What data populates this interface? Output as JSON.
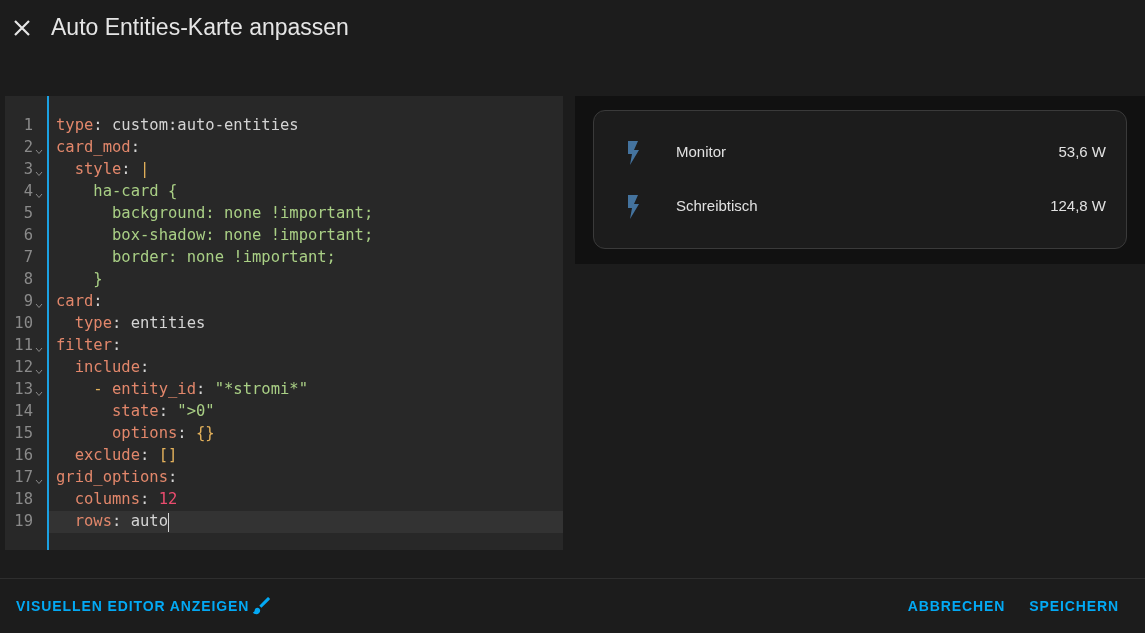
{
  "dialog": {
    "title": "Auto Entities-Karte anpassen"
  },
  "editor": {
    "lines": [
      {
        "number": "1",
        "foldable": false,
        "active": false,
        "tokens": [
          {
            "kind": "key",
            "text": "type"
          },
          {
            "kind": "punct",
            "text": ":"
          },
          {
            "kind": "plain",
            "text": " custom:auto-entities"
          }
        ]
      },
      {
        "number": "2",
        "foldable": true,
        "active": false,
        "tokens": [
          {
            "kind": "key",
            "text": "card_mod"
          },
          {
            "kind": "punct",
            "text": ":"
          }
        ]
      },
      {
        "number": "3",
        "foldable": true,
        "active": false,
        "tokens": [
          {
            "kind": "key",
            "text": "  style"
          },
          {
            "kind": "punct",
            "text": ":"
          },
          {
            "kind": "bracket",
            "text": " |"
          }
        ]
      },
      {
        "number": "4",
        "foldable": true,
        "active": false,
        "tokens": [
          {
            "kind": "string",
            "text": "    ha-card {"
          }
        ]
      },
      {
        "number": "5",
        "foldable": false,
        "active": false,
        "tokens": [
          {
            "kind": "string",
            "text": "      background: none !important;"
          }
        ]
      },
      {
        "number": "6",
        "foldable": false,
        "active": false,
        "tokens": [
          {
            "kind": "string",
            "text": "      box-shadow: none !important;"
          }
        ]
      },
      {
        "number": "7",
        "foldable": false,
        "active": false,
        "tokens": [
          {
            "kind": "string",
            "text": "      border: none !important;"
          }
        ]
      },
      {
        "number": "8",
        "foldable": false,
        "active": false,
        "tokens": [
          {
            "kind": "string",
            "text": "    }"
          }
        ]
      },
      {
        "number": "9",
        "foldable": true,
        "active": false,
        "tokens": [
          {
            "kind": "key",
            "text": "card"
          },
          {
            "kind": "punct",
            "text": ":"
          }
        ]
      },
      {
        "number": "10",
        "foldable": false,
        "active": false,
        "tokens": [
          {
            "kind": "key",
            "text": "  type"
          },
          {
            "kind": "punct",
            "text": ":"
          },
          {
            "kind": "plain",
            "text": " entities"
          }
        ]
      },
      {
        "number": "11",
        "foldable": true,
        "active": false,
        "tokens": [
          {
            "kind": "key",
            "text": "filter"
          },
          {
            "kind": "punct",
            "text": ":"
          }
        ]
      },
      {
        "number": "12",
        "foldable": true,
        "active": false,
        "tokens": [
          {
            "kind": "key",
            "text": "  include"
          },
          {
            "kind": "punct",
            "text": ":"
          }
        ]
      },
      {
        "number": "13",
        "foldable": true,
        "active": false,
        "tokens": [
          {
            "kind": "bracket",
            "text": "    - "
          },
          {
            "kind": "key",
            "text": "entity_id"
          },
          {
            "kind": "punct",
            "text": ":"
          },
          {
            "kind": "string",
            "text": " \"*stromi*\""
          }
        ]
      },
      {
        "number": "14",
        "foldable": false,
        "active": false,
        "tokens": [
          {
            "kind": "key",
            "text": "      state"
          },
          {
            "kind": "punct",
            "text": ":"
          },
          {
            "kind": "string",
            "text": " \">0\""
          }
        ]
      },
      {
        "number": "15",
        "foldable": false,
        "active": false,
        "tokens": [
          {
            "kind": "key",
            "text": "      options"
          },
          {
            "kind": "punct",
            "text": ":"
          },
          {
            "kind": "bracket",
            "text": " {}"
          }
        ]
      },
      {
        "number": "16",
        "foldable": false,
        "active": false,
        "tokens": [
          {
            "kind": "key",
            "text": "  exclude"
          },
          {
            "kind": "punct",
            "text": ":"
          },
          {
            "kind": "bracket",
            "text": " []"
          }
        ]
      },
      {
        "number": "17",
        "foldable": true,
        "active": false,
        "tokens": [
          {
            "kind": "key",
            "text": "grid_options"
          },
          {
            "kind": "punct",
            "text": ":"
          }
        ]
      },
      {
        "number": "18",
        "foldable": false,
        "active": false,
        "tokens": [
          {
            "kind": "key",
            "text": "  columns"
          },
          {
            "kind": "punct",
            "text": ":"
          },
          {
            "kind": "number",
            "text": " 12"
          }
        ]
      },
      {
        "number": "19",
        "foldable": false,
        "active": true,
        "tokens": [
          {
            "kind": "key",
            "text": "  rows"
          },
          {
            "kind": "punct",
            "text": ":"
          },
          {
            "kind": "plain",
            "text": " auto"
          }
        ]
      }
    ]
  },
  "preview": {
    "entities": [
      {
        "name": "Monitor",
        "value": "53,6 W"
      },
      {
        "name": "Schreibtisch",
        "value": "124,8 W"
      }
    ]
  },
  "footer": {
    "left_button": "VISUELLEN EDITOR ANZEIGEN",
    "right_buttons": [
      "ABBRECHEN",
      "SPEICHERN"
    ]
  }
}
